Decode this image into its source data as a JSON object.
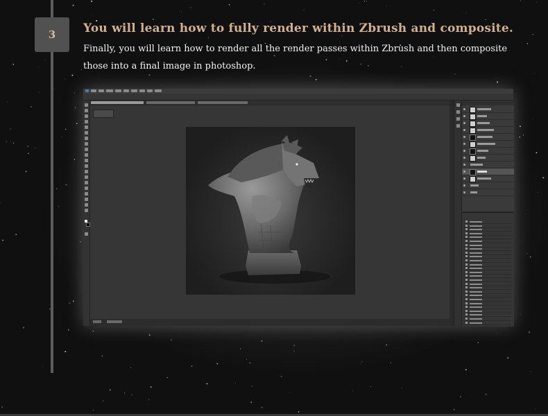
{
  "step": {
    "number": "3",
    "title": "You will learn how to fully render within Zbrush and composite.",
    "description": "Finally, you will learn how to render all the render passes within Zbrush and then composite those into a final image in photoshop."
  },
  "screenshot": {
    "app": "Adobe Photoshop",
    "content": "werewolf-bust-render",
    "icons": [
      "move-tool-icon",
      "eye-icon",
      "layer-thumbnail-icon",
      "history-brush-icon"
    ]
  },
  "colors": {
    "background": "#101010",
    "accent_gold": "#d3b08a",
    "badge": "#515151",
    "timeline": "#5c5c5c"
  }
}
